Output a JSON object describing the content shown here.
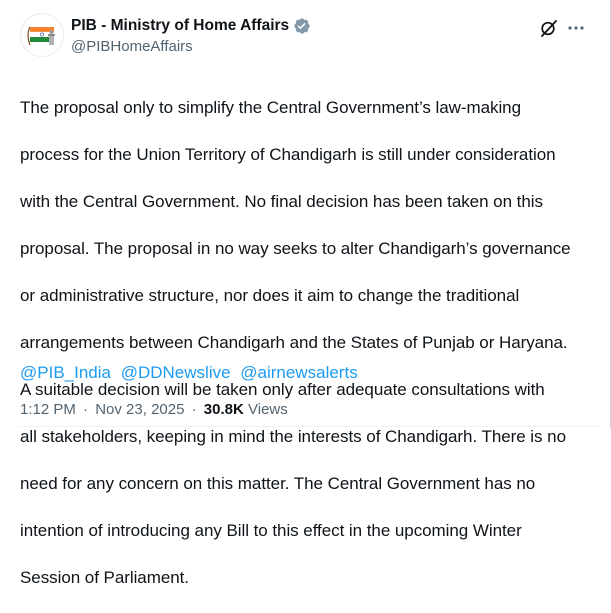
{
  "account": {
    "display_name": "PIB - Ministry of Home Affairs",
    "handle": "@PIBHomeAffairs",
    "verified_icon": "verified-badge-icon",
    "avatar": "emblem-avatar"
  },
  "toolbar": {
    "grok_icon": "grok-icon",
    "more_icon": "more-options-icon"
  },
  "tweet": {
    "body_lines": [
      "The proposal only to simplify the Central Government’s law-making",
      "process for the Union Territory of Chandigarh is still under consideration",
      "with the Central Government. No final decision has been taken on this",
      "proposal. The proposal in no way seeks to alter Chandigarh’s governance",
      "or administrative structure, nor does it aim to change the traditional",
      "arrangements between Chandigarh and the States of Punjab or Haryana.",
      "A suitable decision will be taken only after adequate consultations with",
      "all stakeholders, keeping in mind the interests of Chandigarh. There is no",
      "need for any concern on this matter. The Central Government has no",
      "intention of introducing any Bill to this effect in the upcoming Winter",
      "Session of Parliament."
    ],
    "mentions": [
      "@PIB_India",
      "@DDNewslive",
      "@airnewsalerts"
    ]
  },
  "meta": {
    "time": "1:12 PM",
    "separator": "·",
    "date": "Nov 23, 2025",
    "views_count": "30.8K",
    "views_label": "Views"
  },
  "colors": {
    "accent": "#1d9bf0",
    "text": "#0f1419",
    "secondary": "#536471"
  }
}
